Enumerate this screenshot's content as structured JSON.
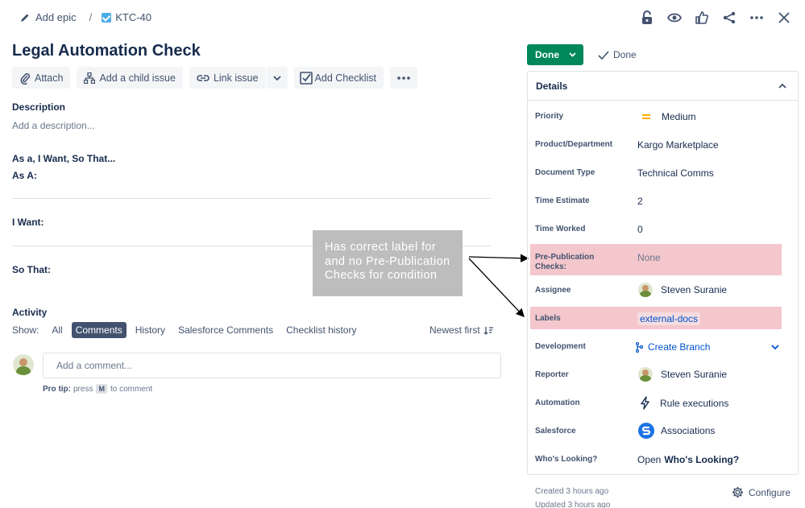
{
  "breadcrumb": {
    "epic_label": "Add epic",
    "separator": "/",
    "issue_key": "KTC-40"
  },
  "issue": {
    "title": "Legal Automation Check"
  },
  "toolbar": {
    "attach": "Attach",
    "add_child": "Add a child issue",
    "link_issue": "Link issue",
    "add_checklist": "Add Checklist"
  },
  "description": {
    "heading": "Description",
    "placeholder": "Add a description..."
  },
  "story": {
    "heading": "As a, I Want, So That...",
    "as_a": "As A:",
    "i_want": "I Want:",
    "so_that": "So That:"
  },
  "activity": {
    "heading": "Activity",
    "show_label": "Show:",
    "filters": [
      "All",
      "Comments",
      "History",
      "Salesforce Comments",
      "Checklist history"
    ],
    "active_filter": "Comments",
    "sort": "Newest first",
    "comment_placeholder": "Add a comment...",
    "protip_bold": "Pro tip:",
    "protip_text1": "press",
    "protip_key": "M",
    "protip_text2": "to comment"
  },
  "annotation": {
    "text": "Has correct label for and no Pre-Publication Checks for condition"
  },
  "status": {
    "button": "Done",
    "resolution": "Done"
  },
  "details": {
    "heading": "Details",
    "fields": {
      "priority": {
        "label": "Priority",
        "value": "Medium"
      },
      "product": {
        "label": "Product/Department",
        "value": "Kargo Marketplace"
      },
      "doctype": {
        "label": "Document Type",
        "value": "Technical Comms"
      },
      "time_estimate": {
        "label": "Time Estimate",
        "value": "2"
      },
      "time_worked": {
        "label": "Time Worked",
        "value": "0"
      },
      "prepub": {
        "label": "Pre-Publication Checks:",
        "value": "None"
      },
      "assignee": {
        "label": "Assignee",
        "value": "Steven Suranie"
      },
      "labels": {
        "label": "Labels",
        "value": "external-docs"
      },
      "development": {
        "label": "Development",
        "value": "Create Branch"
      },
      "reporter": {
        "label": "Reporter",
        "value": "Steven Suranie"
      },
      "automation": {
        "label": "Automation",
        "value": "Rule executions"
      },
      "salesforce": {
        "label": "Salesforce",
        "value": "Associations"
      },
      "whos_looking": {
        "label": "Who's Looking?",
        "value_prefix": "Open",
        "value_bold": "Who's Looking?"
      }
    },
    "created": "Created 3 hours ago",
    "updated": "Updated 3 hours ago",
    "configure": "Configure"
  },
  "colors": {
    "done_green": "#00875a",
    "highlight_pink": "#f4c7cd",
    "link_blue": "#0052cc",
    "annotation_gray": "#bdbdbd"
  },
  "icons": [
    "pencil-icon",
    "checkbox-icon",
    "lock-icon",
    "eye-icon",
    "thumbs-up-icon",
    "share-icon",
    "more-icon",
    "close-icon"
  ]
}
